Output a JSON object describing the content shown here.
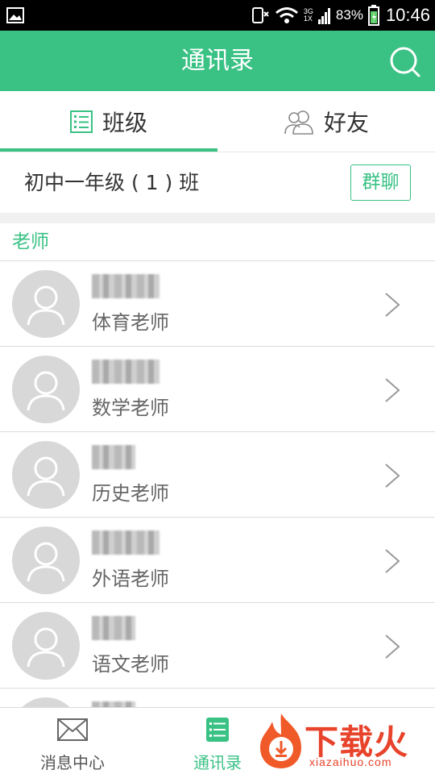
{
  "status_bar": {
    "network_top": "3G",
    "network_bottom": "1X",
    "battery": "83%",
    "time": "10:46"
  },
  "header": {
    "title": "通讯录"
  },
  "tabs": [
    {
      "label": "班级",
      "icon": "list-icon",
      "active": true
    },
    {
      "label": "好友",
      "icon": "friends-icon",
      "active": false
    }
  ],
  "class_row": {
    "name": "初中一年级 ( 1 ) 班",
    "group_chat_label": "群聊"
  },
  "section": {
    "label": "老师"
  },
  "contacts": [
    {
      "role": "体育老师",
      "name_width": 84
    },
    {
      "role": "数学老师",
      "name_width": 84
    },
    {
      "role": "历史老师",
      "name_width": 54
    },
    {
      "role": "外语老师",
      "name_width": 84
    },
    {
      "role": "语文老师",
      "name_width": 54
    }
  ],
  "bottom_nav": {
    "messages_label": "消息中心",
    "contacts_label": "通讯录"
  },
  "watermark": {
    "text": "下载火",
    "url": "xiazaihuo.com"
  },
  "colors": {
    "accent": "#3ac184",
    "watermark": "#e8432b"
  }
}
